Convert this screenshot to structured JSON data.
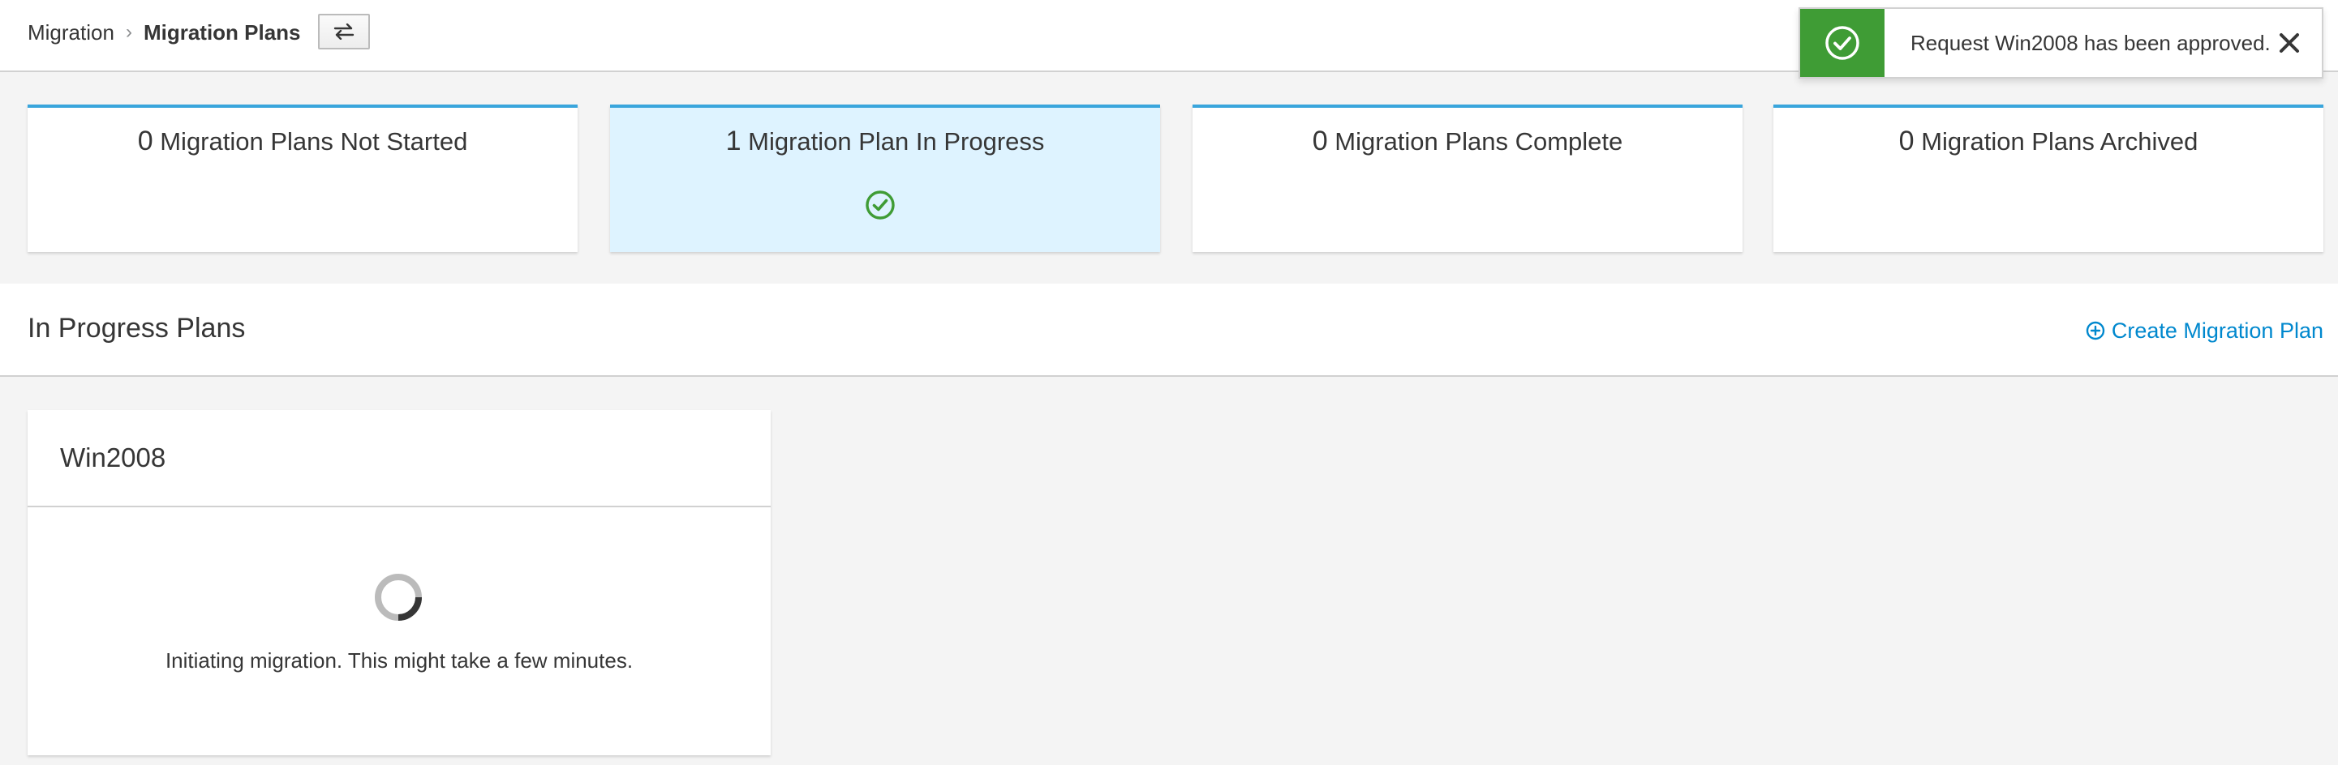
{
  "breadcrumb": {
    "parent": "Migration",
    "separator": "›",
    "current": "Migration Plans"
  },
  "toolbar": {
    "toggle_icon": "exchange-arrows-icon"
  },
  "toast": {
    "message": "Request Win2008 has been approved.",
    "status": "success",
    "color": "#3f9c35"
  },
  "cards": [
    {
      "count": "0",
      "label": "Migration Plans Not Started",
      "active": false
    },
    {
      "count": "1",
      "label": "Migration Plan In Progress",
      "active": true,
      "icon": "check-circle-icon"
    },
    {
      "count": "0",
      "label": "Migration Plans Complete",
      "active": false
    },
    {
      "count": "0",
      "label": "Migration Plans Archived",
      "active": false
    }
  ],
  "section": {
    "title": "In Progress Plans",
    "create_label": "Create Migration Plan"
  },
  "plan": {
    "name": "Win2008",
    "status_message": "Initiating migration. This might take a few minutes."
  },
  "colors": {
    "accent": "#39a5dc",
    "link": "#0088ce",
    "success": "#3f9c35",
    "active_card_bg": "#def3ff"
  }
}
